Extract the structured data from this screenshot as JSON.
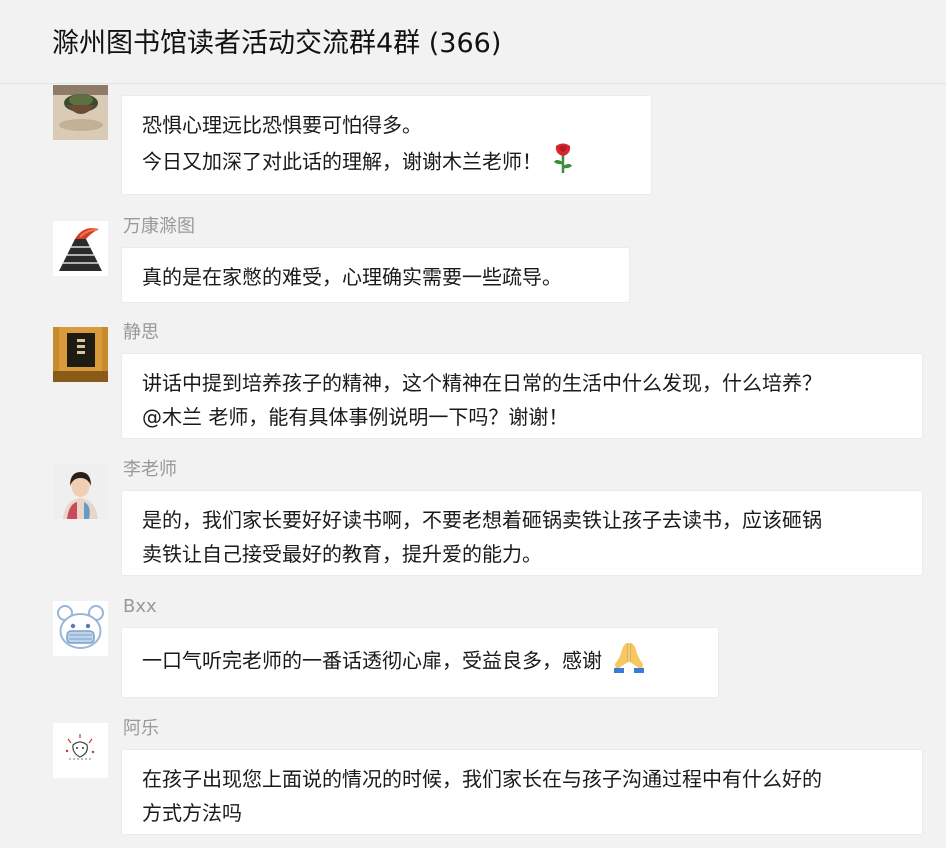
{
  "header": {
    "title": "滁州图书馆读者活动交流群4群 (366)"
  },
  "messages": [
    {
      "sender": "",
      "avatar_icon": "potted-plant-avatar-icon",
      "lines": [
        "恐惧心理远比恐惧要可怕得多。",
        "今日又加深了对此话的理解，谢谢木兰老师！"
      ],
      "emoji": "rose-emoji-icon"
    },
    {
      "sender": "万康滁图",
      "avatar_icon": "volcano-logo-avatar-icon",
      "lines": [
        "真的是在家憋的难受，心理确实需要一些疏导。"
      ]
    },
    {
      "sender": "静思",
      "avatar_icon": "book-cover-avatar-icon",
      "lines": [
        "讲话中提到培养孩子的精神，这个精神在日常的生活中什么发现，什么培养？",
        "@木兰 老师，能有具体事例说明一下吗？谢谢！"
      ]
    },
    {
      "sender": "李老师",
      "avatar_icon": "portrait-avatar-icon",
      "lines": [
        "是的，我们家长要好好读书啊，不要老想着砸锅卖铁让孩子去读书，应该砸锅",
        "卖铁让自己接受最好的教育，提升爱的能力。"
      ]
    },
    {
      "sender": "Bxx",
      "avatar_icon": "bear-mask-avatar-icon",
      "lines": [
        "一口气听完老师的一番话透彻心扉，受益良多，感谢"
      ],
      "emoji": "folded-hands-emoji-icon"
    },
    {
      "sender": "阿乐",
      "avatar_icon": "sketch-avatar-icon",
      "lines": [
        "在孩子出现您上面说的情况的时候，我们家长在与孩子沟通过程中有什么好的",
        "方式方法吗"
      ]
    }
  ]
}
